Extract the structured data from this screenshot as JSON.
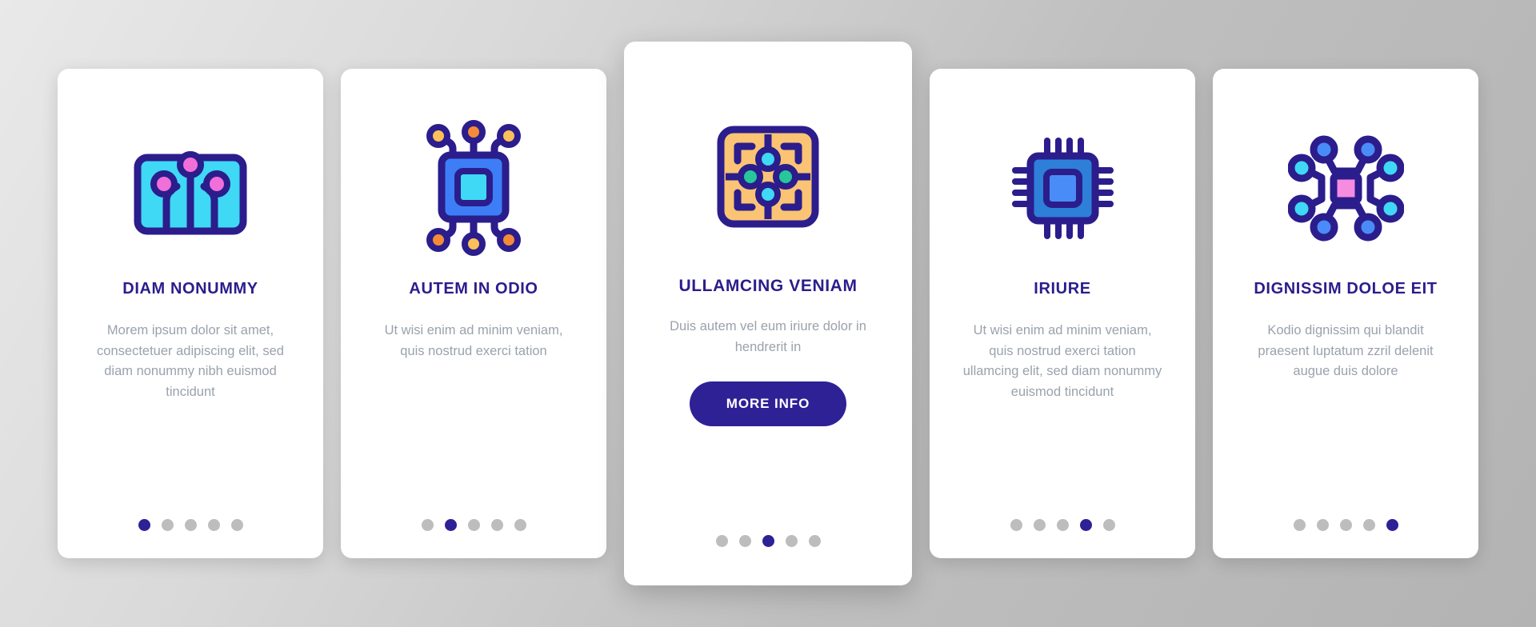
{
  "theme": {
    "accent": "#2e2196",
    "title_color": "#2b1d8c",
    "body_color": "#9aa2ac",
    "dot_inactive": "#bdbdbd",
    "card_bg": "#ffffff",
    "page_bg": "#c9c9c9"
  },
  "cards": [
    {
      "icon_name": "circuit-board-icon",
      "title": "DIAM NONUMMY",
      "body": "Morem ipsum dolor sit amet, consectetuer adipiscing elit, sed diam nonummy nibh euismod tincidunt",
      "dots_total": 5,
      "dot_active_index": 0,
      "featured": false,
      "cta_label": null
    },
    {
      "icon_name": "ai-chip-nodes-icon",
      "title": "AUTEM IN ODIO",
      "body": "Ut wisi enim ad minim veniam, quis nostrud exerci tation",
      "dots_total": 5,
      "dot_active_index": 1,
      "featured": false,
      "cta_label": null
    },
    {
      "icon_name": "quad-core-chip-icon",
      "title": "ULLAMCING VENIAM",
      "body": "Duis autem vel eum iriure dolor in hendrerit in",
      "dots_total": 5,
      "dot_active_index": 2,
      "featured": true,
      "cta_label": "MORE INFO"
    },
    {
      "icon_name": "processor-cpu-icon",
      "title": "IRIURE",
      "body": "Ut wisi enim ad minim veniam, quis nostrud exerci tation ullamcing elit, sed diam nonummy euismod tincidunt",
      "dots_total": 5,
      "dot_active_index": 3,
      "featured": false,
      "cta_label": null
    },
    {
      "icon_name": "neural-network-nodes-icon",
      "title": "DIGNISSIM DOLOE EIT",
      "body": "Kodio dignissim qui blandit praesent luptatum zzril delenit augue duis dolore",
      "dots_total": 5,
      "dot_active_index": 4,
      "featured": false,
      "cta_label": null
    }
  ]
}
